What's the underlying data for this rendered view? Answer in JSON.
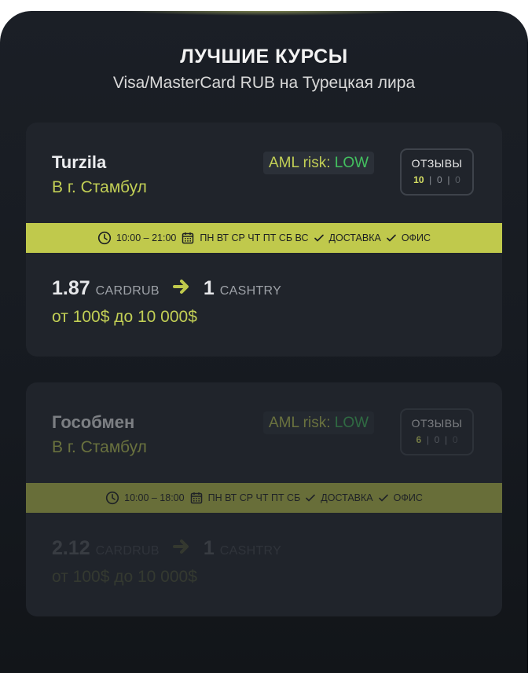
{
  "header": {
    "title": "ЛУЧШИЕ КУРСЫ",
    "subtitle": "Visa/MasterCard RUB на Турецкая лира"
  },
  "colors": {
    "accent": "#c0c94c",
    "low_risk": "#43c05f",
    "card_bg": "#20242b"
  },
  "cards": [
    {
      "name": "Turzila",
      "city": "В г. Стамбул",
      "aml_label": "AML risk:",
      "aml_value": "LOW",
      "reviews_label": "ОТЗЫВЫ",
      "reviews_positive": "10",
      "reviews_neutral": "0",
      "reviews_negative": "0",
      "hours": "10:00 – 21:00",
      "days": "ПН ВТ СР ЧТ ПТ СБ ВС",
      "delivery": "ДОСТАВКА",
      "office": "ОФИС",
      "rate_from": "1.87",
      "currency_from": "CARDRUB",
      "rate_to": "1",
      "currency_to": "CASHTRY",
      "limits": "от 100$ до 10 000$"
    },
    {
      "name": "Гособмен",
      "city": "В г. Стамбул",
      "aml_label": "AML risk:",
      "aml_value": "LOW",
      "reviews_label": "ОТЗЫВЫ",
      "reviews_positive": "6",
      "reviews_neutral": "0",
      "reviews_negative": "0",
      "hours": "10:00 – 18:00",
      "days": "ПН ВТ СР ЧТ ПТ СБ",
      "delivery": "ДОСТАВКА",
      "office": "ОФИС",
      "rate_from": "2.12",
      "currency_from": "CARDRUB",
      "rate_to": "1",
      "currency_to": "CASHTRY",
      "limits": "от 100$ до 10 000$"
    }
  ]
}
